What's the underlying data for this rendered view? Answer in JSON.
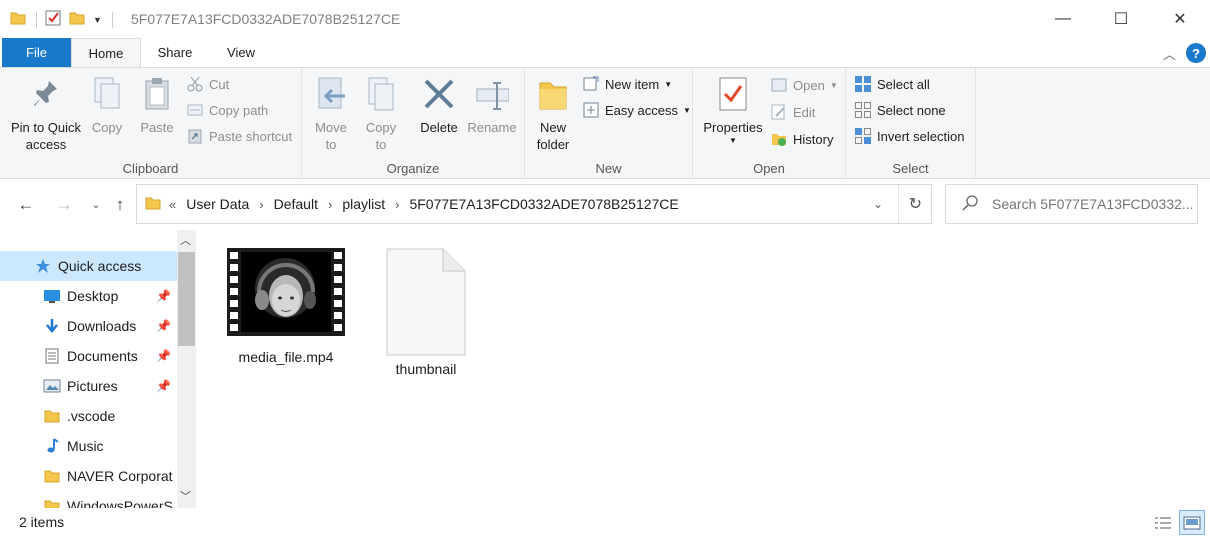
{
  "window": {
    "title": "5F077E7A13FCD0332ADE7078B25127CE",
    "minimize_glyph": "—",
    "maximize_glyph": "☐",
    "close_glyph": "✕"
  },
  "tabs": {
    "file": "File",
    "home": "Home",
    "share": "Share",
    "view": "View"
  },
  "ribbon": {
    "clipboard": {
      "label": "Clipboard",
      "pin": "Pin to Quick\naccess",
      "copy": "Copy",
      "paste": "Paste",
      "cut": "Cut",
      "copy_path": "Copy path",
      "paste_shortcut": "Paste shortcut"
    },
    "organize": {
      "label": "Organize",
      "move_to": "Move\nto",
      "copy_to": "Copy\nto",
      "delete": "Delete",
      "rename": "Rename"
    },
    "new": {
      "label": "New",
      "new_folder": "New\nfolder",
      "new_item": "New item",
      "easy_access": "Easy access"
    },
    "open": {
      "label": "Open",
      "properties": "Properties",
      "open": "Open",
      "edit": "Edit",
      "history": "History"
    },
    "select": {
      "label": "Select",
      "select_all": "Select all",
      "select_none": "Select none",
      "invert_selection": "Invert selection"
    }
  },
  "address": {
    "overflow": "«",
    "crumbs": [
      "User Data",
      "Default",
      "playlist",
      "5F077E7A13FCD0332ADE7078B25127CE"
    ]
  },
  "search": {
    "placeholder": "Search 5F077E7A13FCD0332..."
  },
  "sidebar": {
    "items": [
      {
        "label": "Quick access",
        "icon": "star-icon",
        "selected": true
      },
      {
        "label": "Desktop",
        "icon": "desktop-icon",
        "pinned": true
      },
      {
        "label": "Downloads",
        "icon": "download-icon",
        "pinned": true
      },
      {
        "label": "Documents",
        "icon": "documents-icon",
        "pinned": true
      },
      {
        "label": "Pictures",
        "icon": "pictures-icon",
        "pinned": true
      },
      {
        "label": ".vscode",
        "icon": "folder-icon"
      },
      {
        "label": "Music",
        "icon": "music-icon"
      },
      {
        "label": "NAVER Corporat",
        "icon": "folder-icon"
      },
      {
        "label": "WindowsPowerS",
        "icon": "folder-icon"
      }
    ]
  },
  "files": [
    {
      "name": "media_file.mp4",
      "type": "video"
    },
    {
      "name": "thumbnail",
      "type": "blank"
    }
  ],
  "status": {
    "count": "2 items"
  },
  "colors": {
    "accent": "#1979ca",
    "ribbon_bg": "#f5f6f7",
    "folder": "#f4c64c",
    "selected_bg": "#cce8ff"
  }
}
